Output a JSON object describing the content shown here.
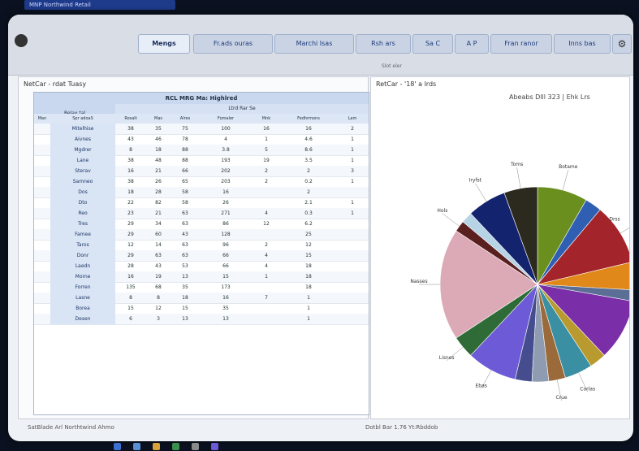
{
  "window": {
    "title": "MNP Northwind Retail"
  },
  "toolbar": {
    "app_name": "",
    "tabs": [
      "Mengs",
      "Fr.ads ouras",
      "Marchi Isas",
      "Rsh ars",
      "Sa C",
      "A P",
      "Fran ranor",
      "Inns bas"
    ],
    "hint": "Slot eler"
  },
  "left_panel": {
    "title": "NetCar - rdat Tuasy",
    "grid": {
      "main_header": "RCL MRG Ma: Highlred",
      "group_header": "Relax tal",
      "sub_header": "Ltrd Rar Se",
      "columns": [
        "Man",
        "Spr adoaS",
        "Rosalt",
        "Mas",
        "Alres",
        "Fomaler",
        "Mnk",
        "Fedhrmons",
        "Lam"
      ],
      "rows": [
        [
          "",
          "Mitelhise",
          "38",
          "35",
          "75",
          "100",
          "16",
          "16",
          "2"
        ],
        [
          "",
          "Aivnes",
          "43",
          "46",
          "78",
          "4",
          "1",
          "4.6",
          "1"
        ],
        [
          "",
          "Mgdrer",
          "8",
          "18",
          "88",
          "3.8",
          "5",
          "8.6",
          "1"
        ],
        [
          "",
          "Lane",
          "38",
          "48",
          "88",
          "193",
          "19",
          "3.5",
          "1"
        ],
        [
          "",
          "Sterav",
          "16",
          "21",
          "66",
          "202",
          "2",
          "2",
          "3"
        ],
        [
          "",
          "Samneo",
          "38",
          "26",
          "65",
          "203",
          "2",
          "0.2",
          "1"
        ],
        [
          "",
          "Dos",
          "18",
          "28",
          "58",
          "16",
          "",
          "2",
          ""
        ],
        [
          "",
          "Dto",
          "22",
          "82",
          "58",
          "26",
          "",
          "2.1",
          "1"
        ],
        [
          "",
          "Reo",
          "23",
          "21",
          "63",
          "271",
          "4",
          "0.3",
          "1"
        ],
        [
          "",
          "Tres",
          "29",
          "34",
          "63",
          "86",
          "12",
          "6.2",
          ""
        ],
        [
          "",
          "Famee",
          "29",
          "60",
          "43",
          "128",
          "",
          "25",
          ""
        ],
        [
          "",
          "Taros",
          "12",
          "14",
          "63",
          "96",
          "2",
          "12",
          ""
        ],
        [
          "",
          "Donr",
          "29",
          "63",
          "63",
          "66",
          "4",
          "15",
          ""
        ],
        [
          "",
          "Laedn",
          "28",
          "43",
          "53",
          "66",
          "4",
          "18",
          ""
        ],
        [
          "",
          "Morne",
          "16",
          "19",
          "13",
          "15",
          "1",
          "18",
          ""
        ],
        [
          "",
          "Forren",
          "135",
          "68",
          "35",
          "173",
          "",
          "18",
          ""
        ],
        [
          "",
          "Lasne",
          "8",
          "8",
          "18",
          "16",
          "7",
          "1",
          ""
        ],
        [
          "",
          "Borea",
          "15",
          "12",
          "15",
          "35",
          "",
          "1",
          ""
        ],
        [
          "",
          "Desen",
          "6",
          "3",
          "13",
          "13",
          "",
          "1",
          ""
        ]
      ]
    }
  },
  "right_panel": {
    "title": "RetCar - '18' a lrds",
    "subtitle": "Abeabs Dlll 323 | Ehk Lrs"
  },
  "chart_data": {
    "type": "pie",
    "title": "Abeabs Dlll 323 | Ehk Lrs",
    "slices": [
      {
        "label": "Botame",
        "value": 9,
        "color": "#6b8f1f"
      },
      {
        "label": "",
        "value": 3,
        "color": "#2f5fb3"
      },
      {
        "label": "Drss",
        "value": 11,
        "color": "#a3242a"
      },
      {
        "label": "",
        "value": 5,
        "color": "#e0891a"
      },
      {
        "label": "",
        "value": 2,
        "color": "#5a6e96"
      },
      {
        "label": "",
        "value": 11,
        "color": "#7a2ea8"
      },
      {
        "label": "",
        "value": 3,
        "color": "#b89a2e"
      },
      {
        "label": "Corlas",
        "value": 5,
        "color": "#3a8fa3"
      },
      {
        "label": "Crue",
        "value": 3,
        "color": "#9a6a3a"
      },
      {
        "label": "",
        "value": 3,
        "color": "#8f9bb0"
      },
      {
        "label": "",
        "value": 3,
        "color": "#454d8f"
      },
      {
        "label": "Ebas",
        "value": 9,
        "color": "#6c5ad6"
      },
      {
        "label": "Lisnes",
        "value": 4,
        "color": "#2e6b36"
      },
      {
        "label": "Nasses",
        "value": 20,
        "color": "#dcaab6"
      },
      {
        "label": "Hols",
        "value": 2,
        "color": "#5a2020"
      },
      {
        "label": "",
        "value": 2,
        "color": "#b7d3e6"
      },
      {
        "label": "Iryfst",
        "value": 7,
        "color": "#14236e"
      },
      {
        "label": "Toms",
        "value": 6,
        "color": "#2c2a1e"
      }
    ]
  },
  "status": {
    "left": "SatBlade Arl Northtwind Ahmo",
    "right": "Dotbl Bar 1.76 Yt:Rbddob"
  },
  "colors": {
    "grid_header": "#c9d8ef",
    "accent": "#1d3a7a"
  }
}
